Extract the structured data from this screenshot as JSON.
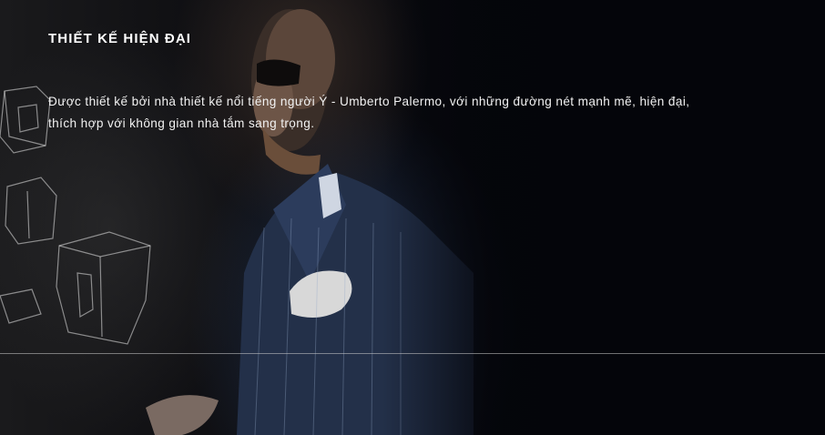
{
  "section": {
    "title": "THIẾT KẾ HIỆN ĐẠI",
    "description_line_1": "Được thiết kế bởi nhà thiết kế nổi tiếng người Ý - Umberto Palermo, với những đường nét mạnh mẽ, hiện đại,",
    "description_line_2": "thích hợp với không gian nhà tắm sang trọng."
  },
  "background_image": {
    "subject": "designer-portrait-with-sketches"
  }
}
